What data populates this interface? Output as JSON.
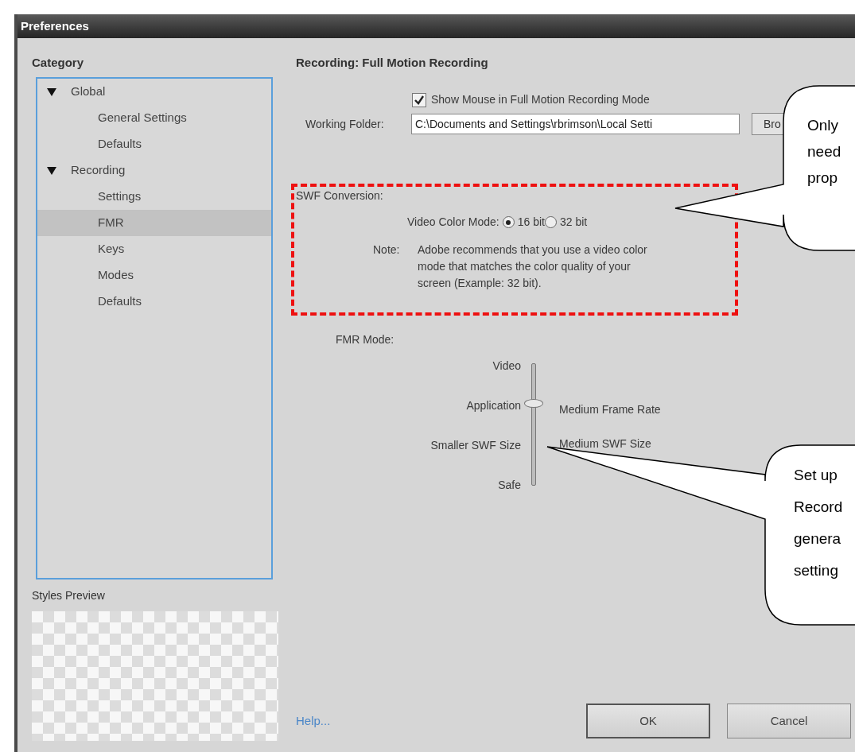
{
  "window": {
    "title": "Preferences"
  },
  "category": {
    "label": "Category",
    "items": [
      {
        "label": "Global",
        "expanded": true,
        "selected": false,
        "children": [
          {
            "label": "General Settings",
            "selected": false
          },
          {
            "label": "Defaults",
            "selected": false
          }
        ]
      },
      {
        "label": "Recording",
        "expanded": true,
        "selected": false,
        "children": [
          {
            "label": "Settings",
            "selected": false
          },
          {
            "label": "FMR",
            "selected": true
          },
          {
            "label": "Keys",
            "selected": false
          },
          {
            "label": "Modes",
            "selected": false
          },
          {
            "label": "Defaults",
            "selected": false
          }
        ]
      }
    ]
  },
  "styles_preview": {
    "label": "Styles Preview"
  },
  "panel": {
    "title": "Recording: Full Motion Recording",
    "show_mouse": {
      "label": "Show Mouse in Full Motion Recording Mode",
      "checked": true
    },
    "working_folder": {
      "label": "Working Folder:",
      "value": "C:\\Documents and Settings\\rbrimson\\Local Setti"
    },
    "browse_button": "Bro",
    "swf_conversion": {
      "label": "SWF Conversion:",
      "video_color_mode": {
        "label": "Video Color Mode:",
        "options": [
          {
            "label": "16 bit",
            "selected": true
          },
          {
            "label": "32 bit",
            "selected": false
          }
        ]
      },
      "note_label": "Note:",
      "note_lines": [
        "Adobe recommends that you use a video color",
        "mode that matches the color quality of your",
        "screen (Example: 32 bit)."
      ]
    },
    "fmr_mode": {
      "label": "FMR Mode:",
      "level": 0.67,
      "stops": [
        "Video",
        "Application",
        "Smaller SWF Size",
        "Safe"
      ],
      "details": [
        "Medium Frame Rate",
        "Medium SWF Size"
      ]
    }
  },
  "footer": {
    "help": "Help...",
    "buttons": [
      "OK",
      "Cancel"
    ]
  },
  "callouts": [
    {
      "lines": [
        "Only",
        "need",
        "prop"
      ]
    },
    {
      "lines": [
        "Set up",
        "Record",
        "genera",
        "setting"
      ]
    }
  ]
}
